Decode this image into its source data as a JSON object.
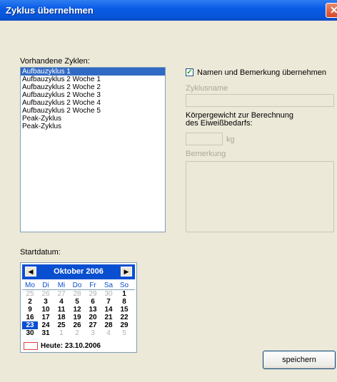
{
  "window": {
    "title": "Zyklus übernehmen",
    "close_symbol": "✕"
  },
  "cycles": {
    "label": "Vorhandene Zyklen:",
    "items": [
      "Aufbauzyklus 1",
      "Aufbauzyklus 2 Woche 1",
      "Aufbauzyklus 2 Woche 2",
      "Aufbauzyklus 2 Woche 3",
      "Aufbauzyklus 2 Woche 4",
      "Aufbauzyklus 2 Woche 5",
      "Peak-Zyklus",
      "Peak-Zyklus"
    ],
    "selected_index": 0
  },
  "options": {
    "checkbox_label": "Namen und Bemerkung übernehmen",
    "checked": true,
    "name_label": "Zyklusname",
    "weight_label_line1": "Körpergewicht zur Berechnung",
    "weight_label_line2": "des Eiweißbedarfs:",
    "weight_unit": "kg",
    "remark_label": "Bemerkung"
  },
  "calendar": {
    "label": "Startdatum:",
    "month": "Oktober 2006",
    "prev_symbol": "◀",
    "next_symbol": "▶",
    "weekdays": [
      "Mo",
      "Di",
      "Mi",
      "Do",
      "Fr",
      "Sa",
      "So"
    ],
    "weeks": [
      [
        {
          "d": "25",
          "o": 1
        },
        {
          "d": "26",
          "o": 1
        },
        {
          "d": "27",
          "o": 1
        },
        {
          "d": "28",
          "o": 1
        },
        {
          "d": "29",
          "o": 1
        },
        {
          "d": "30",
          "o": 1
        },
        {
          "d": "1",
          "o": 0
        }
      ],
      [
        {
          "d": "2",
          "o": 0
        },
        {
          "d": "3",
          "o": 0
        },
        {
          "d": "4",
          "o": 0
        },
        {
          "d": "5",
          "o": 0
        },
        {
          "d": "6",
          "o": 0
        },
        {
          "d": "7",
          "o": 0
        },
        {
          "d": "8",
          "o": 0
        }
      ],
      [
        {
          "d": "9",
          "o": 0
        },
        {
          "d": "10",
          "o": 0
        },
        {
          "d": "11",
          "o": 0
        },
        {
          "d": "12",
          "o": 0
        },
        {
          "d": "13",
          "o": 0
        },
        {
          "d": "14",
          "o": 0
        },
        {
          "d": "15",
          "o": 0
        }
      ],
      [
        {
          "d": "16",
          "o": 0
        },
        {
          "d": "17",
          "o": 0
        },
        {
          "d": "18",
          "o": 0
        },
        {
          "d": "19",
          "o": 0
        },
        {
          "d": "20",
          "o": 0
        },
        {
          "d": "21",
          "o": 0
        },
        {
          "d": "22",
          "o": 0
        }
      ],
      [
        {
          "d": "23",
          "o": 0,
          "t": 1
        },
        {
          "d": "24",
          "o": 0
        },
        {
          "d": "25",
          "o": 0
        },
        {
          "d": "26",
          "o": 0
        },
        {
          "d": "27",
          "o": 0
        },
        {
          "d": "28",
          "o": 0
        },
        {
          "d": "29",
          "o": 0
        }
      ],
      [
        {
          "d": "30",
          "o": 0
        },
        {
          "d": "31",
          "o": 0
        },
        {
          "d": "1",
          "o": 1
        },
        {
          "d": "2",
          "o": 1
        },
        {
          "d": "3",
          "o": 1
        },
        {
          "d": "4",
          "o": 1
        },
        {
          "d": "5",
          "o": 1
        }
      ]
    ],
    "today_text": "Heute: 23.10.2006"
  },
  "actions": {
    "save_label": "speichern"
  }
}
